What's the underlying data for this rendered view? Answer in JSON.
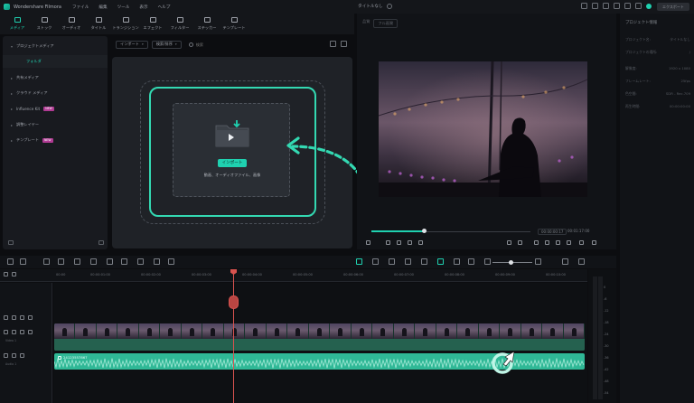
{
  "app": {
    "name": "Wondershare Filmora",
    "document_title": "タイトルなし"
  },
  "menu": [
    "ファイル",
    "編集",
    "ツール",
    "表示",
    "ヘルプ"
  ],
  "export_button": "エクスポート",
  "toolbar": [
    {
      "label": "メディア",
      "icon": "media-icon",
      "active": true
    },
    {
      "label": "ストック",
      "icon": "stock-icon",
      "active": false
    },
    {
      "label": "オーディオ",
      "icon": "audio-icon",
      "active": false
    },
    {
      "label": "タイトル",
      "icon": "title-icon",
      "active": false
    },
    {
      "label": "トランジション",
      "icon": "transition-icon",
      "active": false
    },
    {
      "label": "エフェクト",
      "icon": "effect-icon",
      "active": false
    },
    {
      "label": "フィルター",
      "icon": "filter-icon",
      "active": false
    },
    {
      "label": "ステッカー",
      "icon": "sticker-icon",
      "active": false
    },
    {
      "label": "テンプレート",
      "icon": "template-icon",
      "active": false
    }
  ],
  "sidebar": {
    "items": [
      {
        "label": "プロジェクトメディア"
      },
      {
        "label": "フォルダ"
      },
      {
        "label": "共有メディア"
      },
      {
        "label": "クラウド メディア"
      },
      {
        "label": "Influence Kit",
        "badge": "NEW"
      },
      {
        "label": "調整レイヤー"
      },
      {
        "label": "テンプレート",
        "badge": "NEW"
      }
    ]
  },
  "media": {
    "import_dropdown": "インポート",
    "sort_dropdown": "検索/排序",
    "search_placeholder": "検索",
    "import_button": "インポート",
    "import_hint": "動画、オーディオファイル、画像"
  },
  "player": {
    "quality_label": "品質",
    "quality_value": "フル画質",
    "current_time": "00:00:00:17",
    "total_time": "00:01:17:00"
  },
  "properties": {
    "title": "プロジェクト情報",
    "rows": [
      {
        "k": "プロジェクト名:",
        "v": "タイトルなし"
      },
      {
        "k": "プロジェクトの場所:",
        "v": "/"
      },
      {
        "k": "解像度:",
        "v": "1920 x 1080"
      },
      {
        "k": "フレームレート:",
        "v": "25fps"
      },
      {
        "k": "色空間:",
        "v": "SDR - Rec.709"
      },
      {
        "k": "再生時間:",
        "v": "00:00:00:00"
      }
    ]
  },
  "timeline": {
    "ruler": [
      "00:00",
      "00:00:01:00",
      "00:00:02:00",
      "00:00:03:00",
      "00:00:04:00",
      "00:00:05:00",
      "00:00:06:00",
      "00:00:07:00",
      "00:00:08:00",
      "00:00:09:00",
      "00:00:10:00"
    ],
    "video_track_label": "Video 1",
    "audio_track_label": "Audio 1",
    "audio_clip_name": "24123557867",
    "meter_labels": [
      "0",
      "-6",
      "-12",
      "-18",
      "-24",
      "-30",
      "-36",
      "-42",
      "-48",
      "-54"
    ]
  },
  "colors": {
    "accent": "#1fd1b0",
    "playhead": "#d9534f",
    "badge": "#b03a93"
  }
}
